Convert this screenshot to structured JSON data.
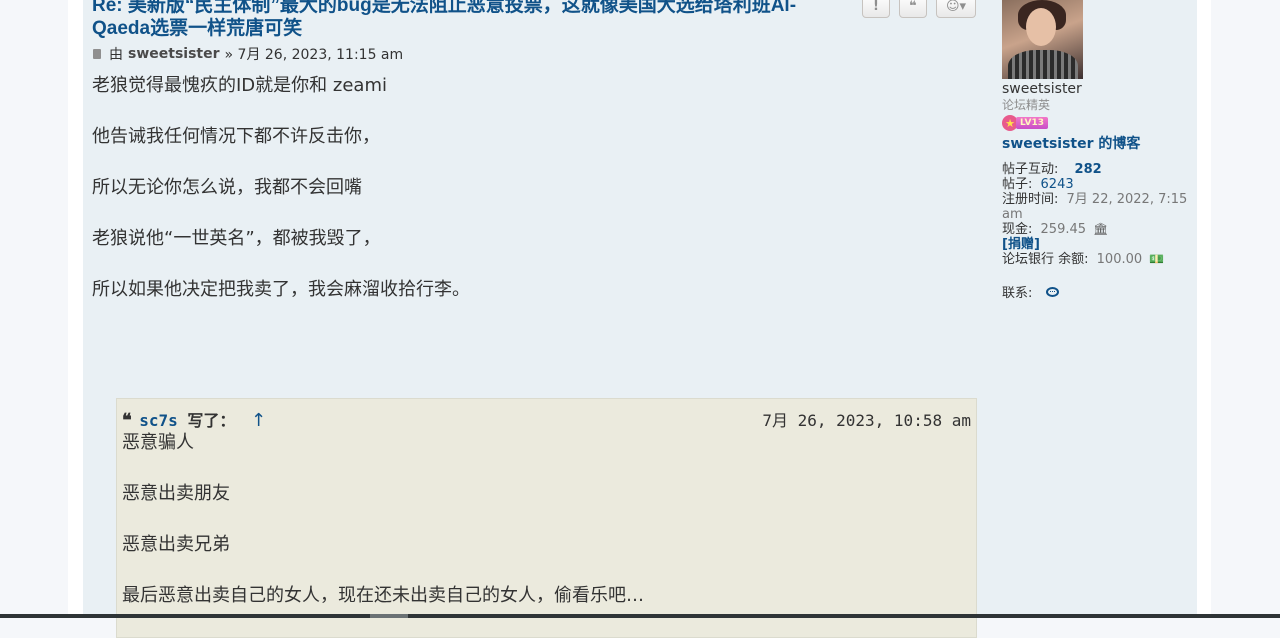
{
  "post": {
    "title_line1": "Re: 美新版“民主体制”最大的bug是无法阻止恶意投票，这就像美国大选给塔利班Al-",
    "title_line2": "Qaeda选票一样荒唐可笑",
    "by_label": "由",
    "author": "sweetsister",
    "date": "» 7月 26, 2023, 11:15 am",
    "buttons": {
      "report": "!",
      "quote": "❝",
      "reaction": "☺▾"
    },
    "paragraphs": [
      "老狼觉得最愧疚的ID就是你和 zeami",
      "他告诫我任何情况下都不许反击你，",
      "所以无论你怎么说，我都不会回嘴",
      "老狼说他“一世英名”，都被我毁了，",
      "所以如果他决定把我卖了，我会麻溜收拾行李。"
    ]
  },
  "quote": {
    "icon": "❝",
    "user": "sc7s",
    "wrote": "写了：",
    "arrow": "↑",
    "time": "7月 26, 2023, 10:58 am",
    "lines": [
      "恶意骗人",
      "恶意出卖朋友",
      "恶意出卖兄弟",
      "最后恶意出卖自己的女人，现在还未出卖自己的女人，偷看乐吧…"
    ]
  },
  "profile": {
    "username": "sweetsister",
    "rank": "论坛精英",
    "level": "LV13",
    "blog": "sweetsister 的博客",
    "interactions_label": "帖子互动:",
    "interactions": "282",
    "posts_label": "帖子:",
    "posts": "6243",
    "joined_label": "注册时间:",
    "joined": "7月 22, 2022, 7:15 am",
    "cash_label": "现金:",
    "cash": "259.45",
    "cash_icon": "🏛",
    "donate": "[捐赠]",
    "bank_label": "论坛银行 余额:",
    "bank": "100.00",
    "bank_icon": "💵",
    "contact_label": "联系:"
  }
}
